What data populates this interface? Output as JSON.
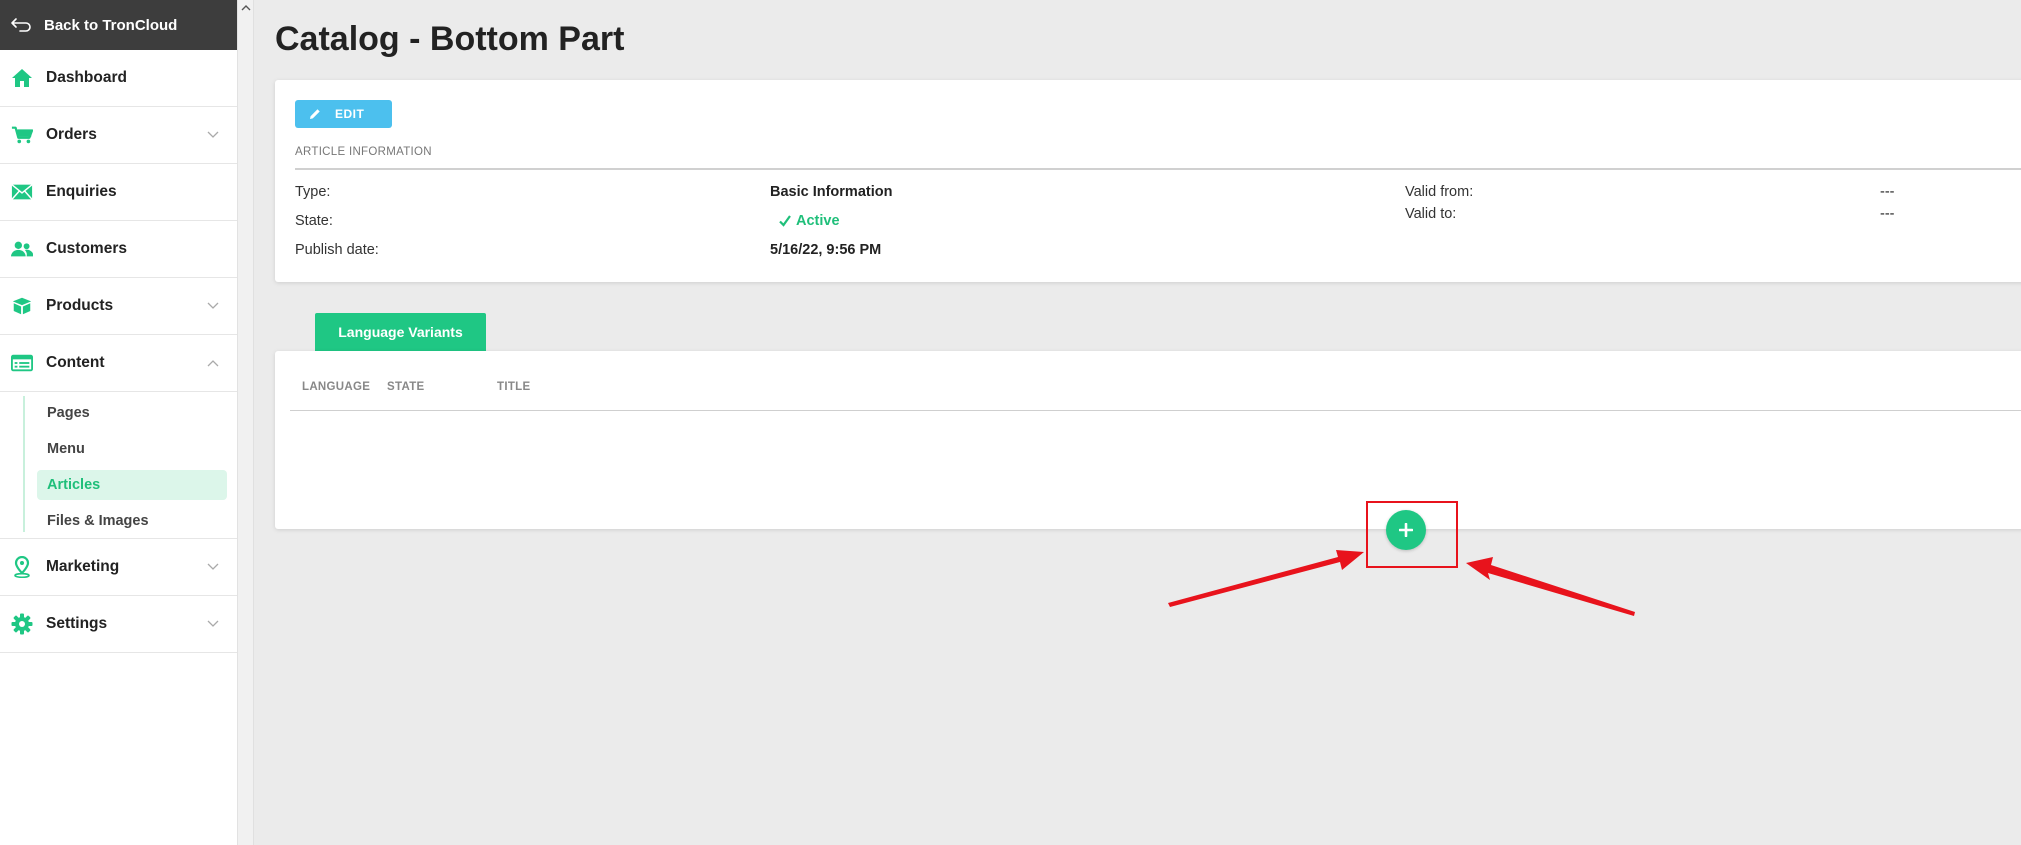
{
  "sidebar": {
    "back_label": "Back to TronCloud",
    "items": [
      {
        "label": "Dashboard",
        "icon": "home-icon",
        "has_chevron": false
      },
      {
        "label": "Orders",
        "icon": "cart-icon",
        "has_chevron": true
      },
      {
        "label": "Enquiries",
        "icon": "envelope-icon",
        "has_chevron": false
      },
      {
        "label": "Customers",
        "icon": "users-icon",
        "has_chevron": false
      },
      {
        "label": "Products",
        "icon": "box-icon",
        "has_chevron": true
      },
      {
        "label": "Content",
        "icon": "content-icon",
        "has_chevron": true,
        "expanded": true
      }
    ],
    "content_sub": [
      "Pages",
      "Menu",
      "Articles",
      "Files & Images"
    ],
    "active_sub": "Articles",
    "items_after": [
      {
        "label": "Marketing",
        "icon": "location-pin-icon",
        "has_chevron": true
      },
      {
        "label": "Settings",
        "icon": "gear-icon",
        "has_chevron": true
      }
    ]
  },
  "page": {
    "title": "Catalog - Bottom Part"
  },
  "info": {
    "edit_label": "EDIT",
    "section_label": "ARTICLE INFORMATION",
    "type_label": "Type:",
    "type_value": "Basic Information",
    "state_label": "State:",
    "state_value": "Active",
    "publish_label": "Publish date:",
    "publish_value": "5/16/22, 9:56 PM",
    "valid_from_label": "Valid from:",
    "valid_from_value": "---",
    "valid_to_label": "Valid to:",
    "valid_to_value": "---"
  },
  "variants": {
    "tab_label": "Language Variants",
    "columns": [
      "LANGUAGE",
      "STATE",
      "TITLE"
    ]
  },
  "colors": {
    "accent_green": "#1fc784",
    "edit_blue": "#4cc0ee",
    "annotation_red": "#e8131c",
    "sidebar_header": "#3d3d3d"
  }
}
